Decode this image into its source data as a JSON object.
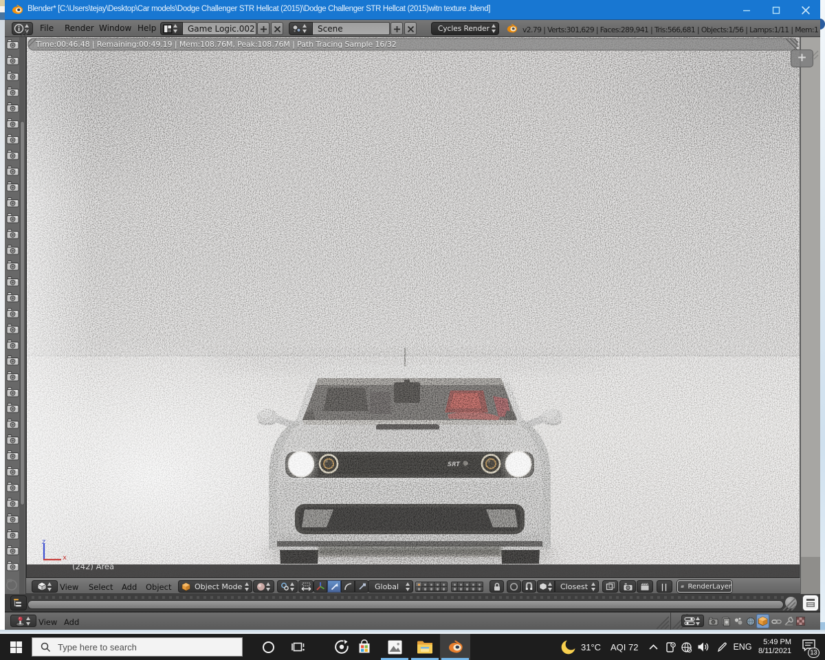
{
  "window": {
    "title": "Blender* [C:\\Users\\tejay\\Desktop\\Car models\\Dodge Challenger STR Hellcat (2015)\\Dodge Challenger STR Hellcat (2015)witn texture .blend]",
    "controls": {
      "minimize": "minimize",
      "maximize": "maximize",
      "close": "close"
    }
  },
  "info_header": {
    "menus": {
      "file": "File",
      "render": "Render",
      "window": "Window",
      "help": "Help"
    },
    "layout_name": "Game Logic.002",
    "scene_name": "Scene",
    "engine": "Cycles Render",
    "stats": "v2.79 | Verts:301,629 | Faces:289,941 | Tris:566,681 | Objects:1/56 | Lamps:1/11 | Mem:1"
  },
  "render_progress": {
    "text": "Time:00:46.48 | Remaining:00:49.19 | Mem:108.76M, Peak:108.76M | Path Tracing Sample 16/32"
  },
  "viewport": {
    "label": "(242) Area",
    "axis_z": "z",
    "axis_x": "x",
    "car_badge": "SRT"
  },
  "view3d_header": {
    "menus": {
      "view": "View",
      "select": "Select",
      "add": "Add",
      "object": "Object"
    },
    "mode": "Object Mode",
    "orientation": "Global",
    "snap_target": "Closest",
    "render_layer": "RenderLayer",
    "pause": "||"
  },
  "logic_header": {
    "menus": {
      "view": "View",
      "add": "Add"
    }
  },
  "taskbar": {
    "search_placeholder": "Type here to search",
    "weather_temp": "31°C",
    "weather_aqi": "AQI 72",
    "language": "ENG",
    "time": "5:49 PM",
    "date": "8/11/2021",
    "notification_count": "13"
  },
  "ui": {
    "plus": "+"
  },
  "colors": {
    "titlebar": "#1877d2",
    "header_gray": "#6d6d6d",
    "accent_active": "#5680c2",
    "taskbar": "#1d1d1d",
    "layer_dot_active": "#e2a25a",
    "run_indicator": "#76b9ed"
  }
}
